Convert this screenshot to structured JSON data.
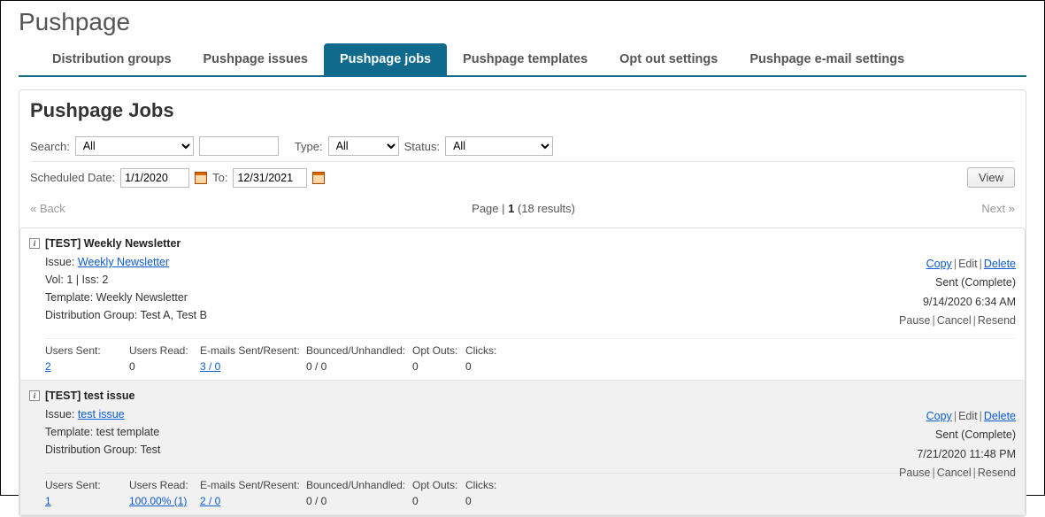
{
  "page_title": "Pushpage",
  "tabs": [
    {
      "label": "Distribution groups",
      "active": false
    },
    {
      "label": "Pushpage issues",
      "active": false
    },
    {
      "label": "Pushpage jobs",
      "active": true
    },
    {
      "label": "Pushpage templates",
      "active": false
    },
    {
      "label": "Opt out settings",
      "active": false
    },
    {
      "label": "Pushpage e-mail settings",
      "active": false
    }
  ],
  "panel_title": "Pushpage Jobs",
  "filters": {
    "search_label": "Search:",
    "search_value": "All",
    "search_text": "",
    "type_label": "Type:",
    "type_value": "All",
    "status_label": "Status:",
    "status_value": "All",
    "sched_label": "Scheduled Date:",
    "date_from": "1/1/2020",
    "to_label": "To:",
    "date_to": "12/31/2021",
    "view_btn": "View"
  },
  "pager": {
    "back": "« Back",
    "prefix": "Page | ",
    "page": "1",
    "results": " (18 results)",
    "next": "Next »"
  },
  "labels": {
    "issue": "Issue: ",
    "vol_iss": "Vol: 1 | Iss: 2",
    "template": "Template: ",
    "dist_group": "Distribution Group:  ",
    "users_sent": "Users Sent:",
    "users_read": "Users Read:",
    "emails": "E-mails Sent/Resent:",
    "bounced": "Bounced/Unhandled:",
    "optouts": "Opt Outs:",
    "clicks": "Clicks:",
    "copy": "Copy",
    "edit": "Edit",
    "delete": "Delete",
    "pause": "Pause",
    "cancel": "Cancel",
    "resend": "Resend"
  },
  "jobs": [
    {
      "title": "[TEST] Weekly Newsletter",
      "issue_link": "Weekly Newsletter",
      "vol_iss": "Vol: 1 | Iss: 2",
      "template": "Weekly Newsletter",
      "dist_group": "Test A, Test B",
      "status": "Sent (Complete)",
      "timestamp": "9/14/2020 6:34 AM",
      "stats": {
        "users_sent": "2",
        "users_sent_link": true,
        "users_read": "0",
        "users_read_link": false,
        "emails": "3 / 0",
        "emails_link": true,
        "bounced": "0 / 0",
        "optouts": "0",
        "clicks": "0"
      }
    },
    {
      "title": "[TEST] test issue",
      "issue_link": "test issue",
      "vol_iss": "",
      "template": "test template",
      "dist_group": "Test",
      "status": "Sent (Complete)",
      "timestamp": "7/21/2020 11:48 PM",
      "stats": {
        "users_sent": "1",
        "users_sent_link": true,
        "users_read": "100.00% (1)",
        "users_read_link": true,
        "emails": "2 / 0",
        "emails_link": true,
        "bounced": "0 / 0",
        "optouts": "0",
        "clicks": "0"
      }
    }
  ]
}
